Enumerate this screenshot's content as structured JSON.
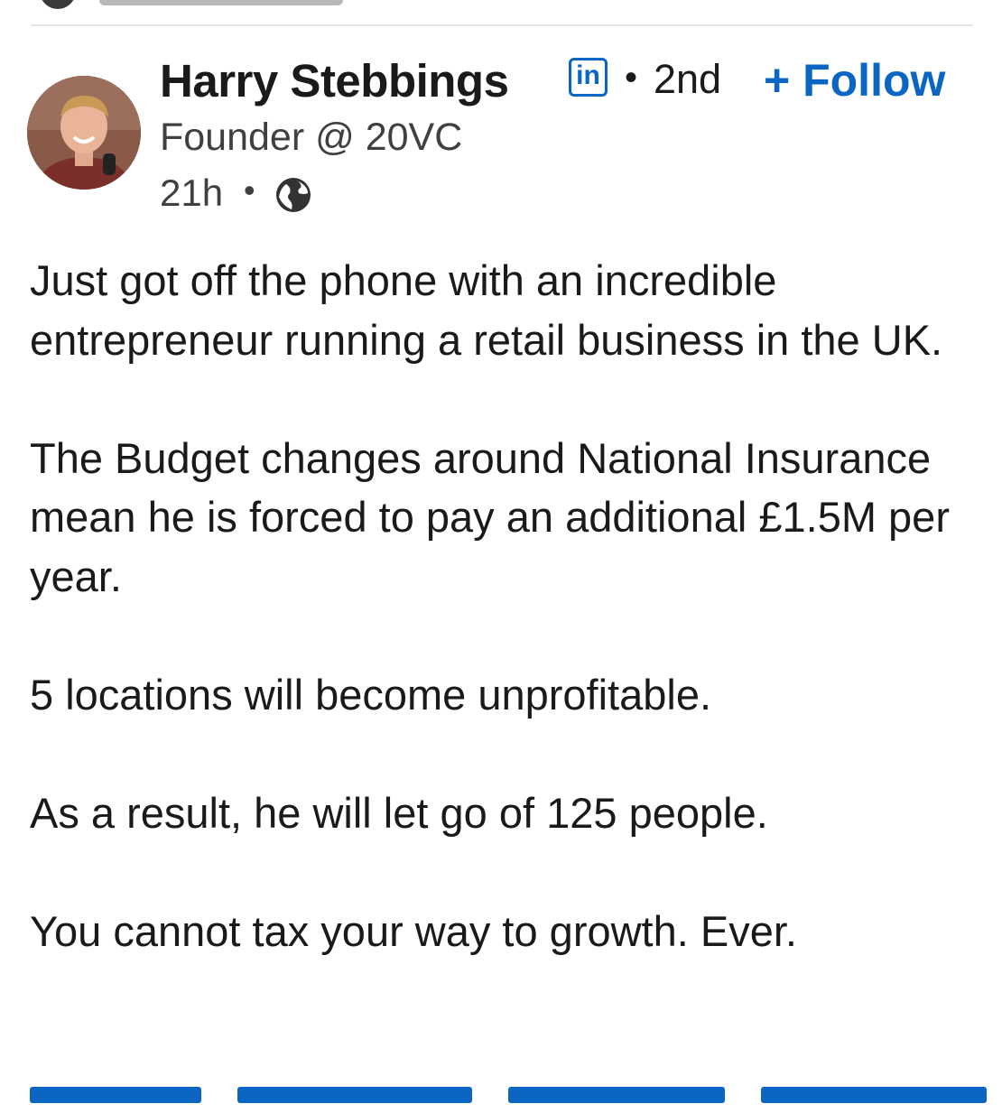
{
  "post": {
    "author": {
      "name": "Harry Stebbings",
      "connection_degree": "2nd",
      "headline": "Founder @ 20VC",
      "badge_icon": "linkedin-icon"
    },
    "follow_label": "+ Follow",
    "timestamp": "21h",
    "visibility_icon": "globe-icon",
    "paragraphs": [
      "Just got off the phone with an incredible entrepreneur running a retail business in the UK.",
      "The Budget changes around National Insurance mean he is forced to pay an additional £1.5M per year.",
      "5 locations will become unprofitable.",
      "As a result, he will let go of 125 people.",
      "You cannot tax your way to growth. Ever."
    ]
  },
  "colors": {
    "link_blue": "#0a66c2",
    "text": "#1a1a1a",
    "secondary_text": "#404040"
  }
}
